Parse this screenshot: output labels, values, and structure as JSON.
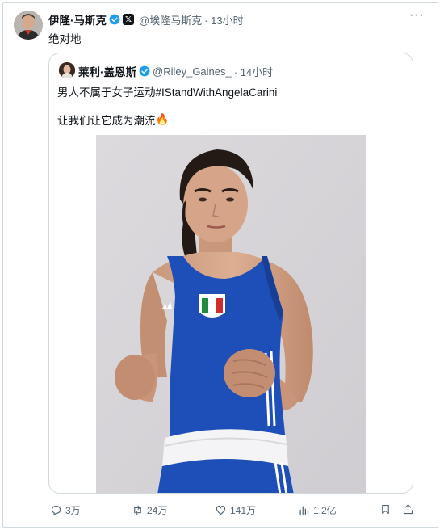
{
  "author": {
    "name": "伊隆·马斯克",
    "handle": "@埃隆马斯克",
    "time": "· 13小时",
    "verified_color": "#1d9bf0"
  },
  "tweet_text": "绝对地",
  "quoted": {
    "name": "莱利·盖恩斯",
    "handle": "@Riley_Gaines_",
    "time": "· 14小时",
    "line1": "男人不属于女子运动#IStandWithAngelaCarini",
    "line2": "让我们让它成为潮流",
    "emoji": "🔥"
  },
  "actions": {
    "replies": "3万",
    "retweets": "24万",
    "likes": "141万",
    "views": "1.2亿"
  },
  "colors": {
    "text": "#0f1419",
    "muted": "#536471",
    "border": "#cfd9de",
    "jersey": "#1e4fb8"
  }
}
